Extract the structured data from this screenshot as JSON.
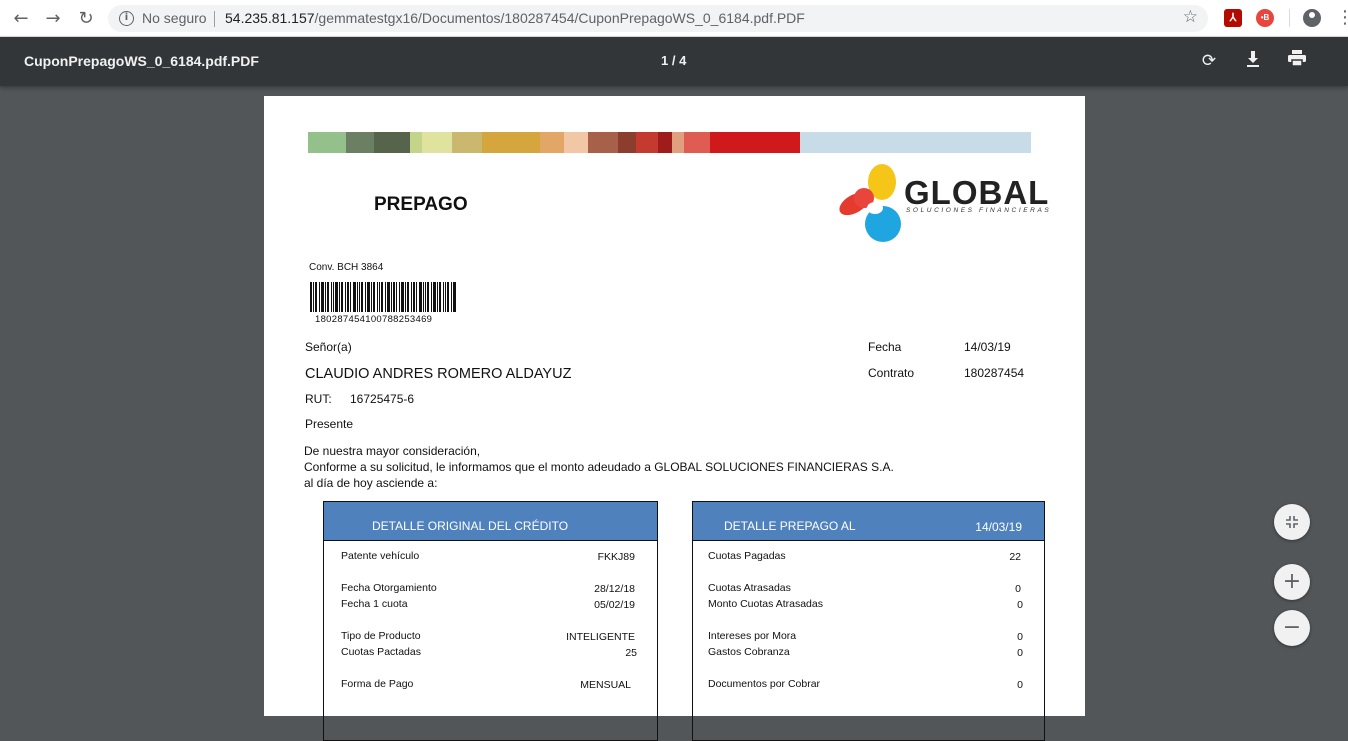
{
  "browser": {
    "security_text": "No seguro",
    "url_host": "54.235.81.157",
    "url_path": "/gemmatestgx16/Documentos/180287454/CuponPrepagoWS_0_6184.pdf.PDF",
    "icons": [
      "back-icon",
      "forward-icon",
      "reload-icon",
      "info-icon",
      "star-icon",
      "pdf-extension-icon",
      "record-extension-icon",
      "profile-icon",
      "menu-icon"
    ],
    "ext_pdf_glyph": "⅄",
    "ext_rec_glyph": "•B"
  },
  "pdf_viewer": {
    "file_name": "CuponPrepagoWS_0_6184.pdf.PDF",
    "page_indicator": "1 / 4",
    "icons": [
      "rotate-icon",
      "download-icon",
      "print-icon",
      "fit-page-icon",
      "zoom-in-icon",
      "zoom-out-icon"
    ]
  },
  "document": {
    "heading": "PREPAGO",
    "logo_name": "GLOBAL",
    "logo_tagline": "SOLUCIONES FINANCIERAS",
    "convenio": "Conv. BCH 3864",
    "barcode_number": "180287454100788253469",
    "senor_label": "Señor(a)",
    "client_name": "CLAUDIO ANDRES ROMERO ALDAYUZ",
    "rut_label": "RUT:",
    "rut_value": "16725475-6",
    "presente": "Presente",
    "fecha_label": "Fecha",
    "fecha_value": "14/03/19",
    "contrato_label": "Contrato",
    "contrato_value": "180287454",
    "intro_line1": "De nuestra mayor consideración,",
    "intro_line2": "Conforme a su solicitud, le informamos que el monto adeudado a GLOBAL SOLUCIONES FINANCIERAS S.A.",
    "intro_line3": "al día de hoy asciende a:",
    "original": {
      "title": "DETALLE ORIGINAL DEL CRÉDITO",
      "rows": [
        {
          "label": "Patente vehículo",
          "value": "FKKJ89"
        },
        {
          "label": "Fecha Otorgamiento",
          "value": "28/12/18"
        },
        {
          "label": "Fecha 1 cuota",
          "value": "05/02/19"
        },
        {
          "label": "Tipo de Producto",
          "value": "INTELIGENTE"
        },
        {
          "label": "Cuotas Pactadas",
          "value": "25"
        },
        {
          "label": "Forma de Pago",
          "value": "MENSUAL"
        }
      ]
    },
    "prepago": {
      "title": "DETALLE PREPAGO AL",
      "date": "14/03/19",
      "rows": [
        {
          "label": "Cuotas Pagadas",
          "value": "22"
        },
        {
          "label": "Cuotas Atrasadas",
          "value": "0"
        },
        {
          "label": "Monto Cuotas Atrasadas",
          "value": "0"
        },
        {
          "label": "Intereses por Mora",
          "value": "0"
        },
        {
          "label": "Gastos Cobranza",
          "value": "0"
        },
        {
          "label": "Documentos por Cobrar",
          "value": "0"
        }
      ]
    }
  },
  "colors": {
    "toolbar": "#323639",
    "viewer_bg": "#525659",
    "box_header": "#4f81bd"
  }
}
